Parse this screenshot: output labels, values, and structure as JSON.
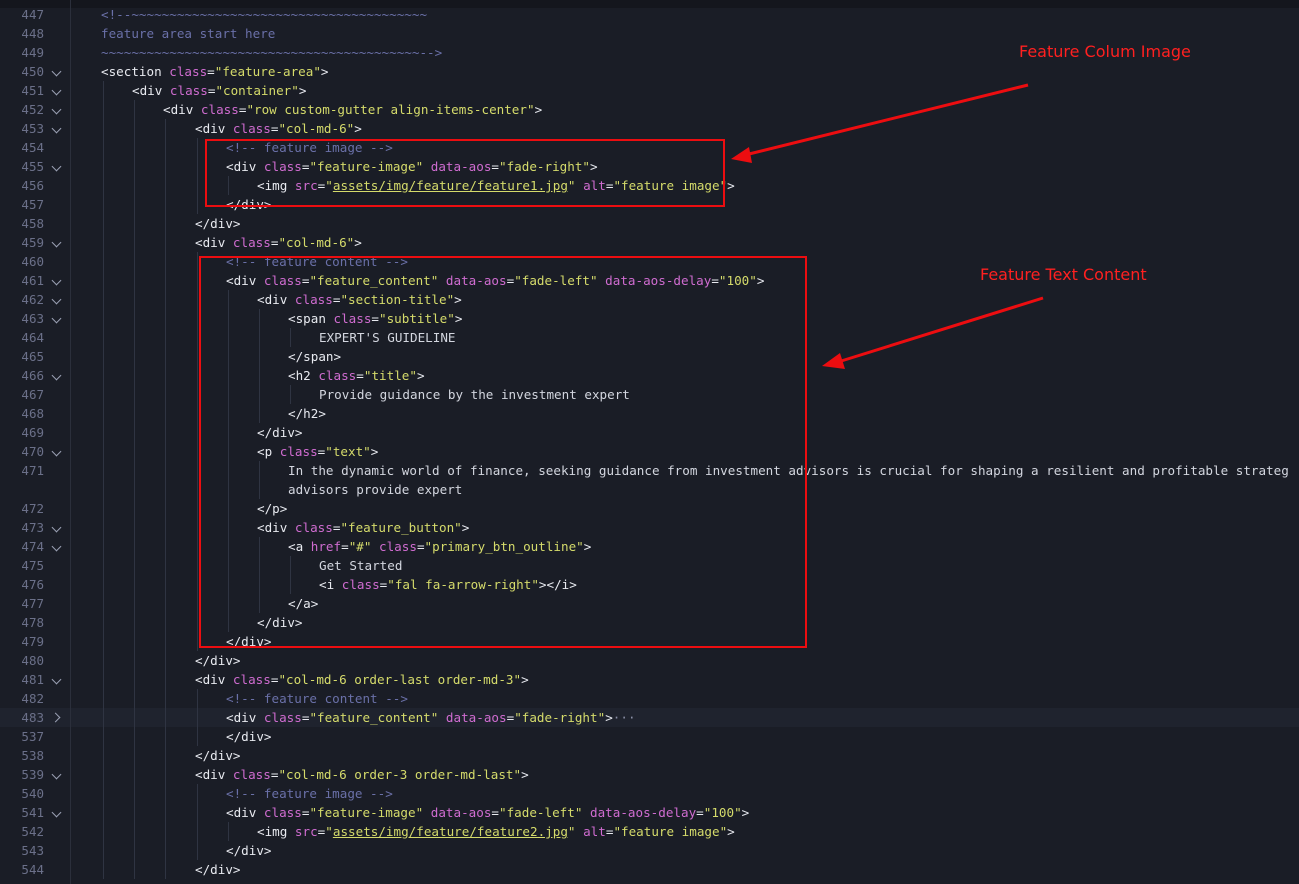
{
  "lines": [
    {
      "num": "447",
      "fold": "none",
      "indent": 1,
      "tokens": [
        {
          "t": "<!--~~~~~~~~~~~~~~~~~~~~~~~~~~~~~~~~~~~~~~~",
          "c": "cm"
        }
      ]
    },
    {
      "num": "448",
      "fold": "none",
      "indent": 1,
      "tokens": [
        {
          "t": "feature area start here",
          "c": "cm"
        }
      ]
    },
    {
      "num": "449",
      "fold": "none",
      "indent": 1,
      "tokens": [
        {
          "t": "~~~~~~~~~~~~~~~~~~~~~~~~~~~~~~~~~~~~~~~~~~-->",
          "c": "cm"
        }
      ]
    },
    {
      "num": "450",
      "fold": "open",
      "indent": 1,
      "tokens": [
        {
          "t": "<section ",
          "c": "tag"
        },
        {
          "t": "class",
          "c": "attr"
        },
        {
          "t": "=",
          "c": "tag"
        },
        {
          "t": "\"feature-area\"",
          "c": "str"
        },
        {
          "t": ">",
          "c": "tag"
        }
      ]
    },
    {
      "num": "451",
      "fold": "open",
      "indent": 2,
      "tokens": [
        {
          "t": "<div ",
          "c": "tag"
        },
        {
          "t": "class",
          "c": "attr"
        },
        {
          "t": "=",
          "c": "tag"
        },
        {
          "t": "\"container\"",
          "c": "str"
        },
        {
          "t": ">",
          "c": "tag"
        }
      ]
    },
    {
      "num": "452",
      "fold": "open",
      "indent": 3,
      "tokens": [
        {
          "t": "<div ",
          "c": "tag"
        },
        {
          "t": "class",
          "c": "attr"
        },
        {
          "t": "=",
          "c": "tag"
        },
        {
          "t": "\"row custom-gutter align-items-center\"",
          "c": "str"
        },
        {
          "t": ">",
          "c": "tag"
        }
      ]
    },
    {
      "num": "453",
      "fold": "open",
      "indent": 4,
      "tokens": [
        {
          "t": "<div ",
          "c": "tag"
        },
        {
          "t": "class",
          "c": "attr"
        },
        {
          "t": "=",
          "c": "tag"
        },
        {
          "t": "\"col-md-6\"",
          "c": "str"
        },
        {
          "t": ">",
          "c": "tag"
        }
      ]
    },
    {
      "num": "454",
      "fold": "none",
      "indent": 5,
      "tokens": [
        {
          "t": "<!-- feature image -->",
          "c": "cm"
        }
      ]
    },
    {
      "num": "455",
      "fold": "open",
      "indent": 5,
      "tokens": [
        {
          "t": "<div ",
          "c": "tag"
        },
        {
          "t": "class",
          "c": "attr"
        },
        {
          "t": "=",
          "c": "tag"
        },
        {
          "t": "\"feature-image\"",
          "c": "str"
        },
        {
          "t": " data-aos",
          "c": "attr"
        },
        {
          "t": "=",
          "c": "tag"
        },
        {
          "t": "\"fade-right\"",
          "c": "str"
        },
        {
          "t": ">",
          "c": "tag"
        }
      ]
    },
    {
      "num": "456",
      "fold": "none",
      "indent": 6,
      "tokens": [
        {
          "t": "<img ",
          "c": "tag"
        },
        {
          "t": "src",
          "c": "attr"
        },
        {
          "t": "=",
          "c": "tag"
        },
        {
          "t": "\"",
          "c": "str"
        },
        {
          "t": "assets/img/feature/feature1.jpg",
          "c": "link"
        },
        {
          "t": "\"",
          "c": "str"
        },
        {
          "t": " alt",
          "c": "attr"
        },
        {
          "t": "=",
          "c": "tag"
        },
        {
          "t": "\"feature image\"",
          "c": "str"
        },
        {
          "t": ">",
          "c": "tag"
        }
      ]
    },
    {
      "num": "457",
      "fold": "none",
      "indent": 5,
      "tokens": [
        {
          "t": "</div>",
          "c": "tag"
        }
      ]
    },
    {
      "num": "458",
      "fold": "none",
      "indent": 4,
      "tokens": [
        {
          "t": "</div>",
          "c": "tag"
        }
      ]
    },
    {
      "num": "459",
      "fold": "open",
      "indent": 4,
      "tokens": [
        {
          "t": "<div ",
          "c": "tag"
        },
        {
          "t": "class",
          "c": "attr"
        },
        {
          "t": "=",
          "c": "tag"
        },
        {
          "t": "\"col-md-6\"",
          "c": "str"
        },
        {
          "t": ">",
          "c": "tag"
        }
      ]
    },
    {
      "num": "460",
      "fold": "none",
      "indent": 5,
      "tokens": [
        {
          "t": "<!-- feature content -->",
          "c": "cm"
        }
      ]
    },
    {
      "num": "461",
      "fold": "open",
      "indent": 5,
      "tokens": [
        {
          "t": "<div ",
          "c": "tag"
        },
        {
          "t": "class",
          "c": "attr"
        },
        {
          "t": "=",
          "c": "tag"
        },
        {
          "t": "\"feature_content\"",
          "c": "str"
        },
        {
          "t": " data-aos",
          "c": "attr"
        },
        {
          "t": "=",
          "c": "tag"
        },
        {
          "t": "\"fade-left\"",
          "c": "str"
        },
        {
          "t": " data-aos-delay",
          "c": "attr"
        },
        {
          "t": "=",
          "c": "tag"
        },
        {
          "t": "\"100\"",
          "c": "str"
        },
        {
          "t": ">",
          "c": "tag"
        }
      ]
    },
    {
      "num": "462",
      "fold": "open",
      "indent": 6,
      "tokens": [
        {
          "t": "<div ",
          "c": "tag"
        },
        {
          "t": "class",
          "c": "attr"
        },
        {
          "t": "=",
          "c": "tag"
        },
        {
          "t": "\"section-title\"",
          "c": "str"
        },
        {
          "t": ">",
          "c": "tag"
        }
      ]
    },
    {
      "num": "463",
      "fold": "open",
      "indent": 7,
      "tokens": [
        {
          "t": "<span ",
          "c": "tag"
        },
        {
          "t": "class",
          "c": "attr"
        },
        {
          "t": "=",
          "c": "tag"
        },
        {
          "t": "\"subtitle\"",
          "c": "str"
        },
        {
          "t": ">",
          "c": "tag"
        }
      ]
    },
    {
      "num": "464",
      "fold": "none",
      "indent": 8,
      "tokens": [
        {
          "t": "EXPERT'S GUIDELINE",
          "c": "txt"
        }
      ]
    },
    {
      "num": "465",
      "fold": "none",
      "indent": 7,
      "tokens": [
        {
          "t": "</span>",
          "c": "tag"
        }
      ]
    },
    {
      "num": "466",
      "fold": "open",
      "indent": 7,
      "tokens": [
        {
          "t": "<h2 ",
          "c": "tag"
        },
        {
          "t": "class",
          "c": "attr"
        },
        {
          "t": "=",
          "c": "tag"
        },
        {
          "t": "\"title\"",
          "c": "str"
        },
        {
          "t": ">",
          "c": "tag"
        }
      ]
    },
    {
      "num": "467",
      "fold": "none",
      "indent": 8,
      "tokens": [
        {
          "t": "Provide guidance by the investment expert",
          "c": "txt"
        }
      ]
    },
    {
      "num": "468",
      "fold": "none",
      "indent": 7,
      "tokens": [
        {
          "t": "</h2>",
          "c": "tag"
        }
      ]
    },
    {
      "num": "469",
      "fold": "none",
      "indent": 6,
      "tokens": [
        {
          "t": "</div>",
          "c": "tag"
        }
      ]
    },
    {
      "num": "470",
      "fold": "open",
      "indent": 6,
      "tokens": [
        {
          "t": "<p ",
          "c": "tag"
        },
        {
          "t": "class",
          "c": "attr"
        },
        {
          "t": "=",
          "c": "tag"
        },
        {
          "t": "\"text\"",
          "c": "str"
        },
        {
          "t": ">",
          "c": "tag"
        }
      ]
    },
    {
      "num": "471",
      "fold": "none",
      "indent": 7,
      "tokens": [
        {
          "t": "In the dynamic world of finance, seeking guidance from investment advisors is crucial for shaping a resilient and profitable strateg",
          "c": "txt"
        }
      ]
    },
    {
      "num": "",
      "fold": "none",
      "indent": 7,
      "tokens": [
        {
          "t": "advisors provide expert",
          "c": "txt"
        }
      ]
    },
    {
      "num": "472",
      "fold": "none",
      "indent": 6,
      "tokens": [
        {
          "t": "</p>",
          "c": "tag"
        }
      ]
    },
    {
      "num": "473",
      "fold": "open",
      "indent": 6,
      "tokens": [
        {
          "t": "<div ",
          "c": "tag"
        },
        {
          "t": "class",
          "c": "attr"
        },
        {
          "t": "=",
          "c": "tag"
        },
        {
          "t": "\"feature_button\"",
          "c": "str"
        },
        {
          "t": ">",
          "c": "tag"
        }
      ]
    },
    {
      "num": "474",
      "fold": "open",
      "indent": 7,
      "tokens": [
        {
          "t": "<a ",
          "c": "tag"
        },
        {
          "t": "href",
          "c": "attr"
        },
        {
          "t": "=",
          "c": "tag"
        },
        {
          "t": "\"#\"",
          "c": "str"
        },
        {
          "t": " class",
          "c": "attr"
        },
        {
          "t": "=",
          "c": "tag"
        },
        {
          "t": "\"primary_btn_outline\"",
          "c": "str"
        },
        {
          "t": ">",
          "c": "tag"
        }
      ]
    },
    {
      "num": "475",
      "fold": "none",
      "indent": 8,
      "tokens": [
        {
          "t": "Get Started",
          "c": "txt"
        }
      ]
    },
    {
      "num": "476",
      "fold": "none",
      "indent": 8,
      "tokens": [
        {
          "t": "<i ",
          "c": "tag"
        },
        {
          "t": "class",
          "c": "attr"
        },
        {
          "t": "=",
          "c": "tag"
        },
        {
          "t": "\"fal fa-arrow-right\"",
          "c": "str"
        },
        {
          "t": "></i>",
          "c": "tag"
        }
      ]
    },
    {
      "num": "477",
      "fold": "none",
      "indent": 7,
      "tokens": [
        {
          "t": "</a>",
          "c": "tag"
        }
      ]
    },
    {
      "num": "478",
      "fold": "none",
      "indent": 6,
      "tokens": [
        {
          "t": "</div>",
          "c": "tag"
        }
      ]
    },
    {
      "num": "479",
      "fold": "none",
      "indent": 5,
      "tokens": [
        {
          "t": "</div>",
          "c": "tag"
        }
      ]
    },
    {
      "num": "480",
      "fold": "none",
      "indent": 4,
      "tokens": [
        {
          "t": "</div>",
          "c": "tag"
        }
      ]
    },
    {
      "num": "481",
      "fold": "open",
      "indent": 4,
      "tokens": [
        {
          "t": "<div ",
          "c": "tag"
        },
        {
          "t": "class",
          "c": "attr"
        },
        {
          "t": "=",
          "c": "tag"
        },
        {
          "t": "\"col-md-6 order-last order-md-3\"",
          "c": "str"
        },
        {
          "t": ">",
          "c": "tag"
        }
      ]
    },
    {
      "num": "482",
      "fold": "none",
      "indent": 5,
      "tokens": [
        {
          "t": "<!-- feature content -->",
          "c": "cm"
        }
      ]
    },
    {
      "num": "483",
      "fold": "closed",
      "indent": 5,
      "current": true,
      "tokens": [
        {
          "t": "<div ",
          "c": "tag"
        },
        {
          "t": "class",
          "c": "attr"
        },
        {
          "t": "=",
          "c": "tag"
        },
        {
          "t": "\"feature_content\"",
          "c": "str"
        },
        {
          "t": " data-aos",
          "c": "attr"
        },
        {
          "t": "=",
          "c": "tag"
        },
        {
          "t": "\"fade-right\"",
          "c": "str"
        },
        {
          "t": ">",
          "c": "tag"
        },
        {
          "t": "···",
          "c": "ell"
        }
      ]
    },
    {
      "num": "537",
      "fold": "none",
      "indent": 5,
      "tokens": [
        {
          "t": "</div>",
          "c": "tag"
        }
      ]
    },
    {
      "num": "538",
      "fold": "none",
      "indent": 4,
      "tokens": [
        {
          "t": "</div>",
          "c": "tag"
        }
      ]
    },
    {
      "num": "539",
      "fold": "open",
      "indent": 4,
      "tokens": [
        {
          "t": "<div ",
          "c": "tag"
        },
        {
          "t": "class",
          "c": "attr"
        },
        {
          "t": "=",
          "c": "tag"
        },
        {
          "t": "\"col-md-6 order-3 order-md-last\"",
          "c": "str"
        },
        {
          "t": ">",
          "c": "tag"
        }
      ]
    },
    {
      "num": "540",
      "fold": "none",
      "indent": 5,
      "tokens": [
        {
          "t": "<!-- feature image -->",
          "c": "cm"
        }
      ]
    },
    {
      "num": "541",
      "fold": "open",
      "indent": 5,
      "tokens": [
        {
          "t": "<div ",
          "c": "tag"
        },
        {
          "t": "class",
          "c": "attr"
        },
        {
          "t": "=",
          "c": "tag"
        },
        {
          "t": "\"feature-image\"",
          "c": "str"
        },
        {
          "t": " data-aos",
          "c": "attr"
        },
        {
          "t": "=",
          "c": "tag"
        },
        {
          "t": "\"fade-left\"",
          "c": "str"
        },
        {
          "t": " data-aos-delay",
          "c": "attr"
        },
        {
          "t": "=",
          "c": "tag"
        },
        {
          "t": "\"100\"",
          "c": "str"
        },
        {
          "t": ">",
          "c": "tag"
        }
      ]
    },
    {
      "num": "542",
      "fold": "none",
      "indent": 6,
      "tokens": [
        {
          "t": "<img ",
          "c": "tag"
        },
        {
          "t": "src",
          "c": "attr"
        },
        {
          "t": "=",
          "c": "tag"
        },
        {
          "t": "\"",
          "c": "str"
        },
        {
          "t": "assets/img/feature/feature2.jpg",
          "c": "link"
        },
        {
          "t": "\"",
          "c": "str"
        },
        {
          "t": " alt",
          "c": "attr"
        },
        {
          "t": "=",
          "c": "tag"
        },
        {
          "t": "\"feature image\"",
          "c": "str"
        },
        {
          "t": ">",
          "c": "tag"
        }
      ]
    },
    {
      "num": "543",
      "fold": "none",
      "indent": 5,
      "tokens": [
        {
          "t": "</div>",
          "c": "tag"
        }
      ]
    },
    {
      "num": "544",
      "fold": "none",
      "indent": 4,
      "tokens": [
        {
          "t": "</div>",
          "c": "tag"
        }
      ]
    }
  ],
  "annotations": {
    "image_label": "Feature Colum Image",
    "text_label": "Feature Text Content",
    "color": "#ec0d10"
  },
  "theme": {
    "background": "#1a1d26",
    "tag": "#e8eaf0",
    "attribute": "#cf6cd0",
    "string": "#d5db6b",
    "comment": "#6a70a8"
  }
}
